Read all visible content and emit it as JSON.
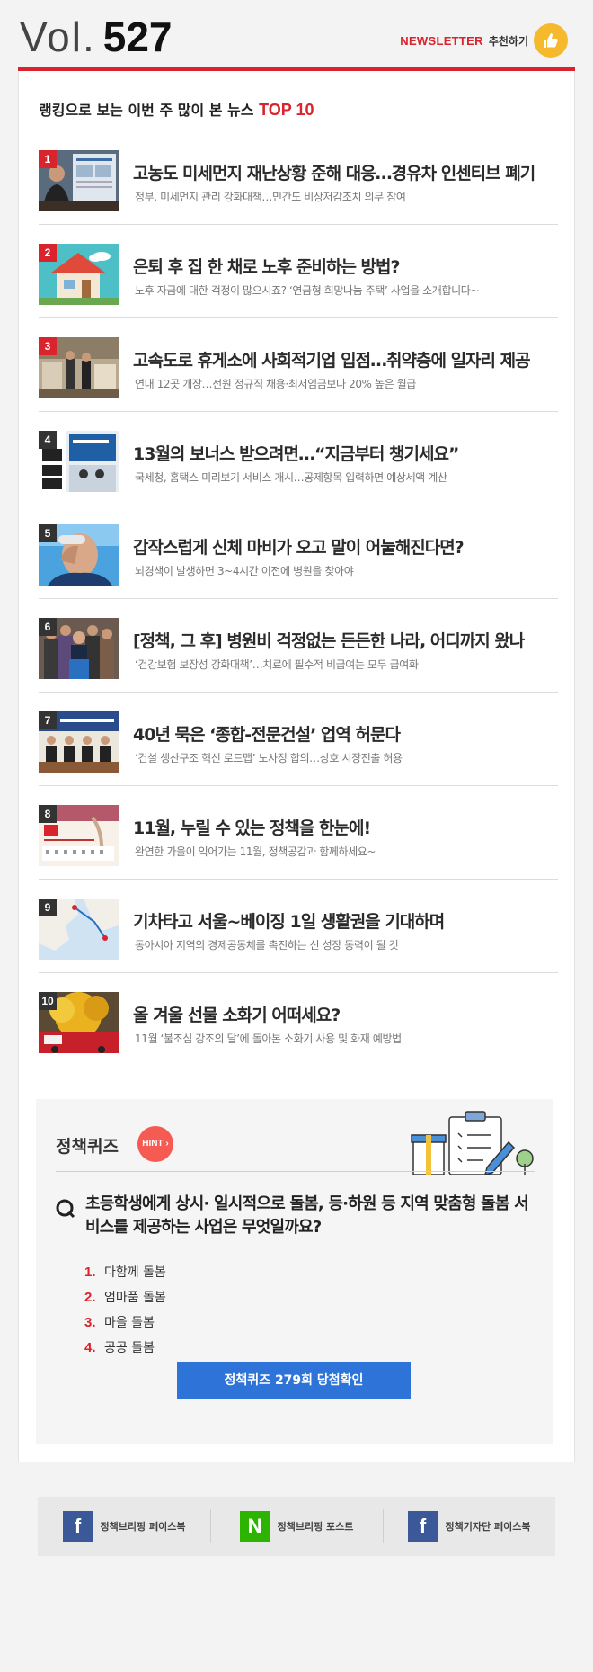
{
  "header": {
    "vol_label": "Vol.",
    "vol_number": "527",
    "newsletter_brand": "NEWSLETTER",
    "recommend_label": "추천하기",
    "accent_color": "#d9232d"
  },
  "ranking": {
    "title_prefix": "랭킹으로 보는 이번 주 많이 본 뉴스",
    "title_top": "TOP 10",
    "items": [
      {
        "rank": "1",
        "title": "고농도 미세먼지 재난상황 준해 대응…경유차 인센티브 폐기",
        "subtitle": "정부, 미세먼지 관리 강화대책…민간도 비상저감조치 의무 참여"
      },
      {
        "rank": "2",
        "title": "은퇴 후 집 한 채로 노후 준비하는 방법?",
        "subtitle": "노후 자금에 대한 걱정이 많으시죠?  ‘연금형 희망나눔 주택’ 사업을 소개합니다~"
      },
      {
        "rank": "3",
        "title": "고속도로 휴게소에 사회적기업 입점…취약층에 일자리 제공",
        "subtitle": "연내 12곳 개장…전원 정규직 채용·최저임금보다 20% 높은 월급"
      },
      {
        "rank": "4",
        "title": "13월의 보너스 받으려면…“지금부터 챙기세요”",
        "subtitle": "국세청, 홈택스 미리보기 서비스 개시…공제항목 입력하면 예상세액 계산"
      },
      {
        "rank": "5",
        "title": "갑작스럽게 신체 마비가 오고 말이 어눌해진다면?",
        "subtitle": "뇌경색이 발생하면 3~4시간 이전에 병원을 찾아야"
      },
      {
        "rank": "6",
        "title": "[정책, 그 후] 병원비 걱정없는 든든한 나라, 어디까지 왔나",
        "subtitle": "‘건강보험 보장성 강화대책’…치료에 필수적 비급여는 모두 급여화"
      },
      {
        "rank": "7",
        "title": "40년 묵은 ‘종합-전문건설’ 업역 허문다",
        "subtitle": "‘건설 생산구조 혁신 로드맵’ 노사정 합의…상호 시장진출 허용"
      },
      {
        "rank": "8",
        "title": "11월, 누릴 수 있는 정책을 한눈에!",
        "subtitle": "완연한 가을이 익어가는 11월, 정책공감과 함께하세요~"
      },
      {
        "rank": "9",
        "title": "기차타고 서울~베이징 1일 생활권을 기대하며",
        "subtitle": "동아시아 지역의 경제공동체를 촉진하는 신 성장 동력이 될 것"
      },
      {
        "rank": "10",
        "title": "올 겨울 선물 소화기 어떠세요?",
        "subtitle": "11월 ‘불조심 강조의 달’에 돌아본 소화기 사용 및 화재 예방법"
      }
    ]
  },
  "quiz": {
    "title": "정책퀴즈",
    "hint_label": "HINT",
    "question": "초등학생에게 상시· 일시적으로 돌봄, 등·하원 등 지역 맞춤형 돌봄 서비스를 제공하는 사업은 무엇일까요?",
    "options": [
      {
        "num": "1.",
        "label": "다함께 돌봄"
      },
      {
        "num": "2.",
        "label": "엄마품 돌봄"
      },
      {
        "num": "3.",
        "label": "마을 돌봄"
      },
      {
        "num": "4.",
        "label": "공공 돌봄"
      }
    ],
    "button_label": "정책퀴즈 279회 당첨확인"
  },
  "footer": {
    "links": [
      {
        "icon": "f",
        "label": "정책브리핑 페이스북"
      },
      {
        "icon": "N",
        "label": "정책브리핑 포스트"
      },
      {
        "icon": "f",
        "label": "정책기자단 페이스북"
      }
    ]
  }
}
